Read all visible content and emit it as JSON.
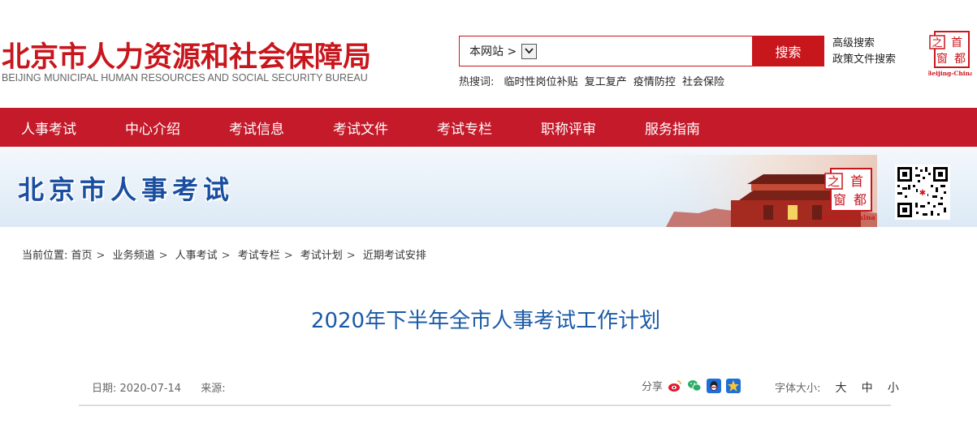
{
  "header": {
    "title": "北京市人力资源和社会保障局",
    "subtitle": "BEIJING MUNICIPAL HUMAN RESOURCES AND SOCIAL SECURITY BUREAU",
    "search": {
      "scope_label": "本网站 >",
      "input_value": "",
      "button_label": "搜索"
    },
    "advanced_search": "高级搜索",
    "policy_search": "政策文件搜索",
    "hot": {
      "label": "热搜词:",
      "terms": [
        "临时性岗位补贴",
        "复工复产",
        "疫情防控",
        "社会保险"
      ]
    },
    "capital_logo": {
      "chars": [
        "首",
        "都",
        "之",
        "窗"
      ],
      "caption": "Beijing-China"
    }
  },
  "nav": {
    "items": [
      "人事考试",
      "中心介绍",
      "考试信息",
      "考试文件",
      "考试专栏",
      "职称评审",
      "服务指南"
    ]
  },
  "banner": {
    "title": "北京市人事考试",
    "logo_caption": "Beijing-China"
  },
  "breadcrumb": {
    "label": "当前位置:",
    "items": [
      "首页",
      "业务频道",
      "人事考试",
      "考试专栏",
      "考试计划",
      "近期考试安排"
    ]
  },
  "article": {
    "title": "2020年下半年全市人事考试工作计划",
    "date_label": "日期:",
    "date": "2020-07-14",
    "source_label": "来源:",
    "source": "",
    "share_label": "分享",
    "share_icons": [
      "weibo-icon",
      "wechat-icon",
      "qq-icon",
      "qzone-icon"
    ],
    "font_size_label": "字体大小:",
    "font_sizes": [
      "大",
      "中",
      "小"
    ]
  },
  "colors": {
    "brand_red": "#c8161d",
    "nav_red": "#c41a2a",
    "title_blue": "#1a5aa6",
    "banner_blue": "#1a4ea1"
  }
}
